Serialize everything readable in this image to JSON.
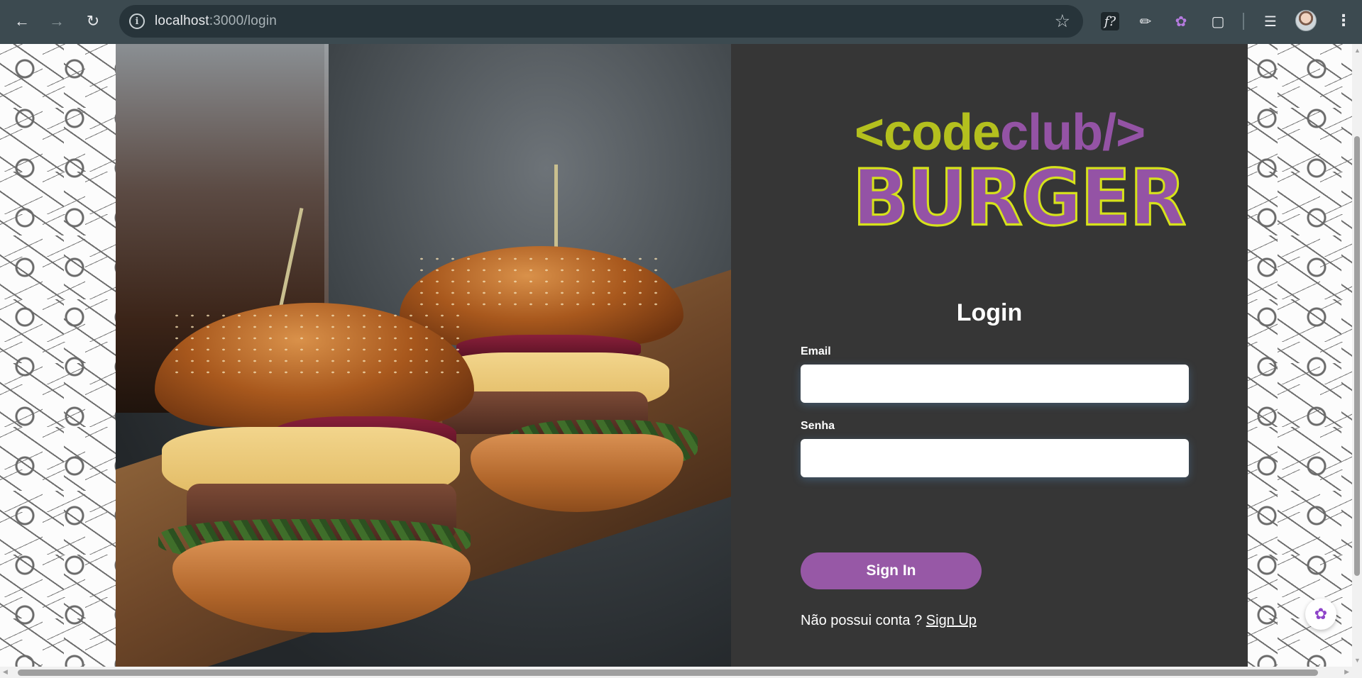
{
  "browser": {
    "back_icon": "arrow-left-icon",
    "forward_icon": "arrow-right-icon",
    "reload_icon": "reload-icon",
    "url_host": "localhost",
    "url_path": ":3000/login",
    "bookmark_icon": "star-icon",
    "extensions": [
      "f?",
      "eyedropper-icon",
      "brain-icon",
      "puzzle-icon"
    ],
    "menu_icon": "kebab-icon"
  },
  "logo": {
    "part1": "<code",
    "part2": "club/>",
    "part3": "BURGER",
    "colors": {
      "green": "#b4c01e",
      "purple": "#9453a5",
      "outline": "#d6e21b"
    }
  },
  "form": {
    "title": "Login",
    "email_label": "Email",
    "email_value": "",
    "password_label": "Senha",
    "password_value": "",
    "submit_label": "Sign In",
    "signup_prompt": "Não possui conta ? ",
    "signup_link": "Sign Up"
  },
  "theme": {
    "panel_bg": "#363636",
    "button_bg": "#9758a6"
  }
}
